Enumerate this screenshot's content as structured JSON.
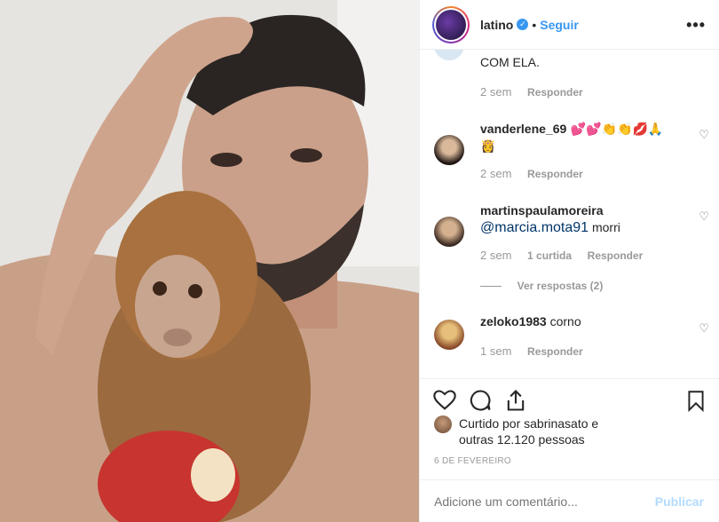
{
  "post": {
    "photo_alt": "man holding monkey eating apple"
  },
  "header": {
    "username": "latino",
    "verified_icon": "verified-badge-icon",
    "dot": "•",
    "follow_label": "Seguir",
    "more_label": "•••"
  },
  "comments": {
    "partial": {
      "text": "COM ELA.",
      "time": "2 sem",
      "reply": "Responder"
    },
    "items": [
      {
        "user": "vanderlene_69",
        "text": "💕💕👏👏💋🙏",
        "text2": "👸",
        "time": "2 sem",
        "likes": "",
        "reply": "Responder"
      },
      {
        "user": "martinspaulamoreira",
        "mention": "@marcia.mota91",
        "text": " morri",
        "time": "2 sem",
        "likes": "1 curtida",
        "reply": "Responder",
        "view_replies": "Ver respostas (2)"
      },
      {
        "user": "zeloko1983",
        "text": " corno",
        "time": "1 sem",
        "reply": "Responder"
      }
    ]
  },
  "likes": {
    "line1": "Curtido por sabrinasato e",
    "line2": "outras 12.120 pessoas"
  },
  "date": "6 DE FEVEREIRO",
  "composer": {
    "placeholder": "Adicione um comentário...",
    "publish": "Publicar"
  }
}
